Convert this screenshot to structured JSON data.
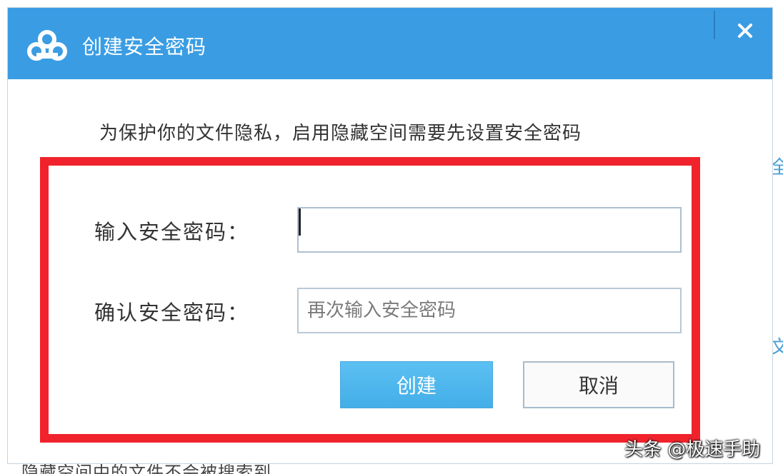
{
  "dialog": {
    "title": "创建安全密码",
    "close_label": "✕",
    "intro": "为保护你的文件隐私，启用隐藏空间需要先设置安全密码",
    "fields": [
      {
        "label": "输入安全密码：",
        "value": "",
        "placeholder": ""
      },
      {
        "label": "确认安全密码：",
        "value": "",
        "placeholder": "再次输入安全密码"
      }
    ],
    "buttons": {
      "confirm": "创建",
      "cancel": "取消"
    }
  },
  "background": {
    "right_glyph_1": "全",
    "right_glyph_2": "文",
    "bottom_text": "隐藏空间中的文件不会被搜索到"
  },
  "watermark": "头条 @极速手助",
  "colors": {
    "titlebar": "#3a9de3",
    "highlight_border": "#f0232d",
    "primary_button": "#4fb6ec"
  },
  "icons": {
    "logo": "cloud-logo-icon",
    "close": "close-icon"
  }
}
